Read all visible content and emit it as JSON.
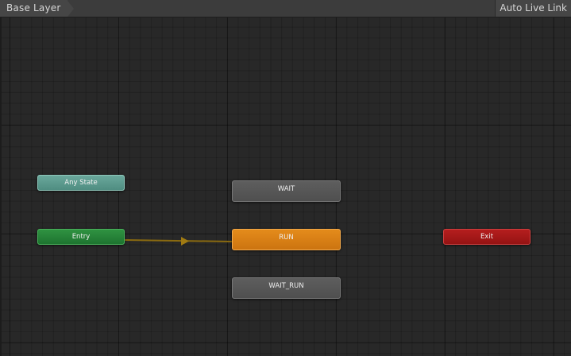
{
  "toolbar": {
    "breadcrumb_label": "Base Layer",
    "live_link_label": "Auto Live Link"
  },
  "states": {
    "any_state": "Any State",
    "entry": "Entry",
    "wait": "WAIT",
    "run": "RUN",
    "wait_run": "WAIT_RUN",
    "exit": "Exit"
  },
  "colors": {
    "canvas_background": "#282828",
    "any_state": "#5a998d",
    "entry": "#268238",
    "default_state": "#e07f16",
    "state": "#565656",
    "exit": "#a81818",
    "transition": "#8a6a10"
  },
  "transitions": [
    {
      "from": "Entry",
      "to": "RUN"
    }
  ]
}
